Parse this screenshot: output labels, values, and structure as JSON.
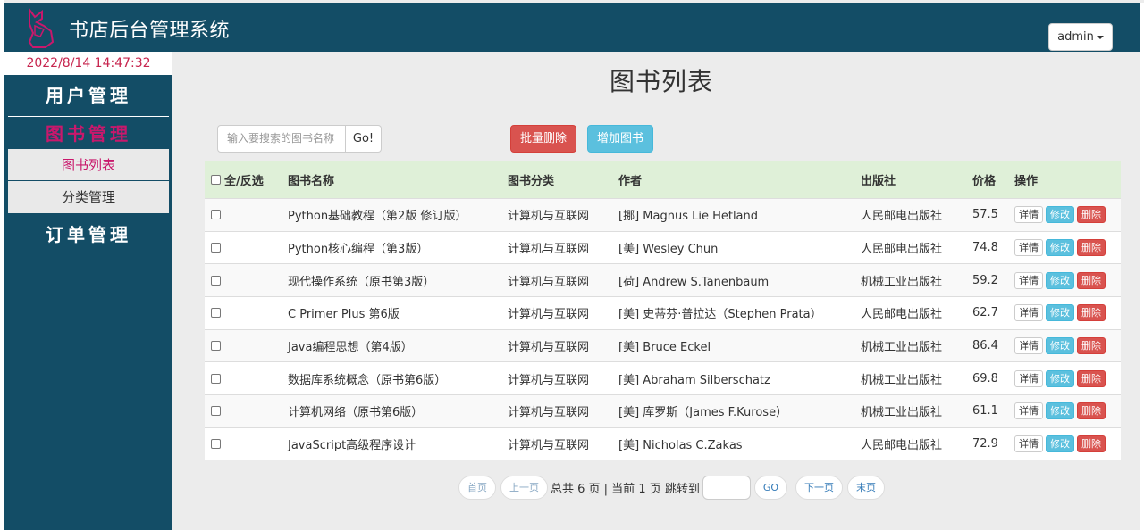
{
  "header": {
    "title": "书店后台管理系统",
    "user_menu_label": "admin",
    "logo_icon": "bookstore-logo-icon"
  },
  "clock": "2022/8/14 14:47:32",
  "sidebar": {
    "sections": {
      "users": "用户管理",
      "books": "图书管理",
      "orders": "订单管理"
    },
    "book_items": [
      "图书列表",
      "分类管理"
    ]
  },
  "main": {
    "title": "图书列表",
    "search_placeholder": "输入要搜索的图书名称",
    "go_label": "Go!",
    "batch_delete_label": "批量删除",
    "add_book_label": "增加图书"
  },
  "table": {
    "headers": {
      "select": "全/反选",
      "name": "图书名称",
      "category": "图书分类",
      "author": "作者",
      "publisher": "出版社",
      "price": "价格",
      "ops": "操作"
    },
    "ops": {
      "detail": "详情",
      "edit": "修改",
      "delete": "删除"
    },
    "rows": [
      {
        "name": "Python基础教程（第2版 修订版）",
        "category": "计算机与互联网",
        "author": "[挪] Magnus Lie Hetland",
        "publisher": "人民邮电出版社",
        "price": "57.5"
      },
      {
        "name": "Python核心编程（第3版）",
        "category": "计算机与互联网",
        "author": "[美] Wesley Chun",
        "publisher": "人民邮电出版社",
        "price": "74.8"
      },
      {
        "name": "现代操作系统（原书第3版）",
        "category": "计算机与互联网",
        "author": "[荷] Andrew S.Tanenbaum",
        "publisher": "机械工业出版社",
        "price": "59.2"
      },
      {
        "name": "C Primer Plus 第6版",
        "category": "计算机与互联网",
        "author": "[美] 史蒂芬·普拉达（Stephen Prata）",
        "publisher": "人民邮电出版社",
        "price": "62.7"
      },
      {
        "name": "Java编程思想（第4版）",
        "category": "计算机与互联网",
        "author": "[美] Bruce Eckel",
        "publisher": "机械工业出版社",
        "price": "86.4"
      },
      {
        "name": "数据库系统概念（原书第6版）",
        "category": "计算机与互联网",
        "author": "[美] Abraham Silberschatz",
        "publisher": "机械工业出版社",
        "price": "69.8"
      },
      {
        "name": "计算机网络（原书第6版）",
        "category": "计算机与互联网",
        "author": "[美] 库罗斯（James F.Kurose）",
        "publisher": "机械工业出版社",
        "price": "61.1"
      },
      {
        "name": "JavaScript高级程序设计",
        "category": "计算机与互联网",
        "author": "[美] Nicholas C.Zakas",
        "publisher": "人民邮电出版社",
        "price": "72.9"
      }
    ]
  },
  "pagination": {
    "first": "首页",
    "prev": "上一页",
    "info": "总共 6 页 | 当前 1 页 跳转到",
    "go": "GO",
    "next": "下一页",
    "last": "末页"
  }
}
